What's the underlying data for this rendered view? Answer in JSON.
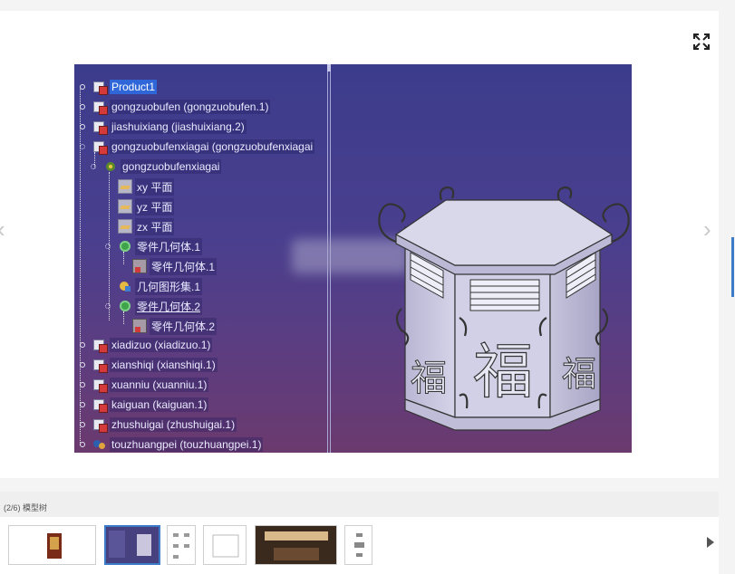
{
  "viewer": {
    "expand_icon": "expand-icon",
    "prev_icon": "chevron-left-icon",
    "next_icon": "chevron-right-icon",
    "prev_glyph": "‹",
    "next_glyph": "›"
  },
  "image": {
    "tree_nodes": [
      {
        "label": "Product1",
        "selected": true
      },
      {
        "label": "gongzuobufen (gongzuobufen.1)"
      },
      {
        "label": "jiashuixiang (jiashuixiang.2)"
      },
      {
        "label": "gongzuobufenxiagai (gongzuobufenxiagai"
      },
      {
        "label": "gongzuobufenxiagai"
      },
      {
        "label": "xy 平面"
      },
      {
        "label": "yz 平面"
      },
      {
        "label": "zx 平面"
      },
      {
        "label": "零件几何体.1"
      },
      {
        "label": "零件几何体.1"
      },
      {
        "label": "几何图形集.1"
      },
      {
        "label": "零件几何体.2"
      },
      {
        "label": "零件几何体.2"
      },
      {
        "label": "xiadizuo (xiadizuo.1)"
      },
      {
        "label": "xianshiqi (xianshiqi.1)"
      },
      {
        "label": "xuanniu (xuanniu.1)"
      },
      {
        "label": "kaiguan (kaiguan.1)"
      },
      {
        "label": "zhushuigai (zhushuigai.1)"
      },
      {
        "label": "touzhuangpei (touzhuangpei.1)"
      }
    ],
    "model_char": "福",
    "colors": {
      "background_top": "#3c3c8c",
      "background_bottom": "#6b3a6e",
      "selection": "#2f66d8",
      "model": "#c9c6de"
    }
  },
  "caption": "(2/6) 模型树",
  "thumbnails": [
    {
      "name": "thumbnail-1",
      "active": false
    },
    {
      "name": "thumbnail-2",
      "active": true
    },
    {
      "name": "thumbnail-3",
      "active": false
    },
    {
      "name": "thumbnail-4",
      "active": false
    },
    {
      "name": "thumbnail-5",
      "active": false
    },
    {
      "name": "thumbnail-6",
      "active": false
    }
  ],
  "thumbs_next_icon": "play-right-icon"
}
